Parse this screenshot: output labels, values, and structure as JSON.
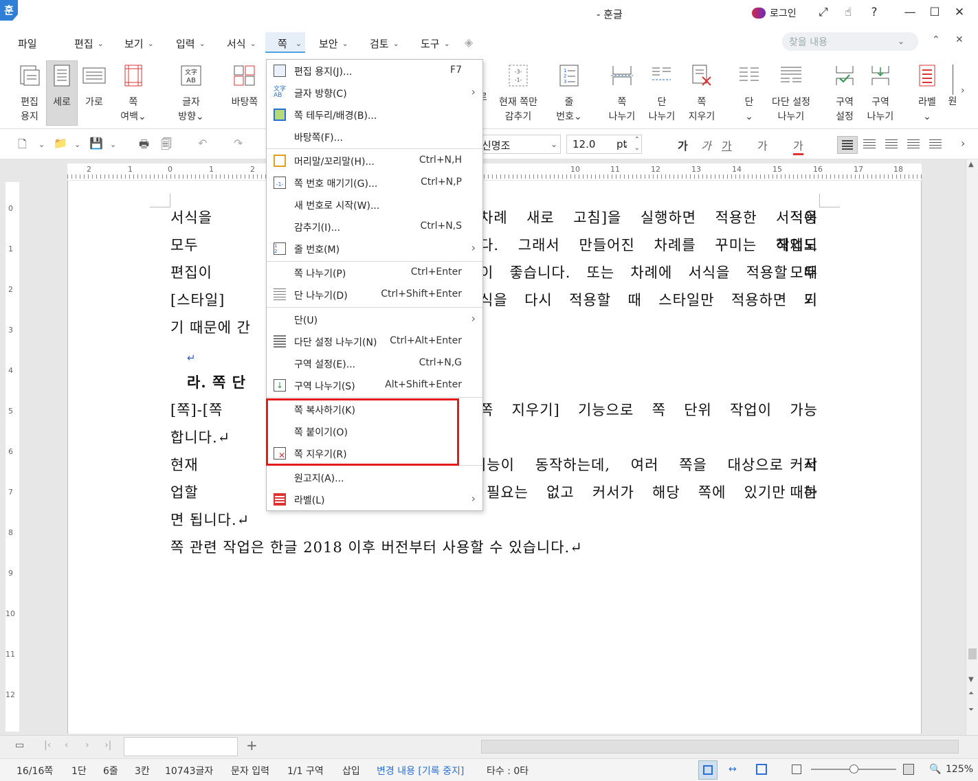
{
  "window": {
    "title": "- 훈글",
    "login": "로그인",
    "logo": "훈"
  },
  "menus": [
    "파일",
    "편집",
    "보기",
    "입력",
    "서식",
    "쪽",
    "보안",
    "검토",
    "도구"
  ],
  "search_placeholder": "찾을 내용",
  "ribbon": [
    {
      "label1": "편집",
      "label2": "용지"
    },
    {
      "label1": "세로",
      "label2": ""
    },
    {
      "label1": "가로",
      "label2": ""
    },
    {
      "label1": "쪽",
      "label2": "여백⌄"
    },
    {
      "label1": "글자",
      "label2": "방향⌄"
    },
    {
      "label1": "바탕쪽",
      "label2": ""
    },
    {
      "label1": "현재 쪽만",
      "label2": "감추기"
    },
    {
      "label1": "줄",
      "label2": "번호⌄"
    },
    {
      "label1": "쪽",
      "label2": "나누기"
    },
    {
      "label1": "단",
      "label2": "나누기"
    },
    {
      "label1": "쪽",
      "label2": "지우기"
    },
    {
      "label1": "단",
      "label2": "⌄"
    },
    {
      "label1": "다단 설정",
      "label2": "나누기"
    },
    {
      "label1": "구역",
      "label2": "설정"
    },
    {
      "label1": "구역",
      "label2": "나누기"
    },
    {
      "label1": "라벨",
      "label2": "⌄"
    },
    {
      "label1": "원",
      "label2": ""
    }
  ],
  "ribbon_partial": "로",
  "font": {
    "name": "신명조",
    "size": "12.0",
    "unit": "pt"
  },
  "format_glyphs": [
    "가",
    "가",
    "가",
    "가",
    "가"
  ],
  "dropdown": [
    {
      "icon": "page-setup-icon",
      "label": "편집 용지(J)...",
      "shortcut": "F7",
      "arrow": ""
    },
    {
      "icon": "text-direction-icon",
      "label": "글자 방향(C)",
      "shortcut": "",
      "arrow": "›"
    },
    {
      "icon": "page-border-icon",
      "label": "쪽 테두리/배경(B)...",
      "shortcut": "",
      "arrow": ""
    },
    {
      "icon": "",
      "label": "바탕쪽(F)...",
      "shortcut": "",
      "arrow": ""
    },
    {
      "icon": "header-footer-icon",
      "label": "머리말/꼬리말(H)...",
      "shortcut": "Ctrl+N,H",
      "arrow": ""
    },
    {
      "icon": "page-number-icon",
      "label": "쪽 번호 매기기(G)...",
      "shortcut": "Ctrl+N,P",
      "arrow": ""
    },
    {
      "icon": "",
      "label": "새 번호로 시작(W)...",
      "shortcut": "",
      "arrow": ""
    },
    {
      "icon": "",
      "label": "감추기(I)...",
      "shortcut": "Ctrl+N,S",
      "arrow": ""
    },
    {
      "icon": "line-number-icon",
      "label": "줄 번호(M)",
      "shortcut": "",
      "arrow": "›"
    },
    {
      "icon": "page-break-icon",
      "label": "쪽 나누기(P)",
      "shortcut": "Ctrl+Enter",
      "arrow": ""
    },
    {
      "icon": "column-break-icon",
      "label": "단 나누기(D)",
      "shortcut": "Ctrl+Shift+Enter",
      "arrow": ""
    },
    {
      "icon": "",
      "label": "단(U)",
      "shortcut": "",
      "arrow": "›"
    },
    {
      "icon": "multi-column-icon",
      "label": "다단 설정 나누기(N)",
      "shortcut": "Ctrl+Alt+Enter",
      "arrow": ""
    },
    {
      "icon": "",
      "label": "구역 설정(E)...",
      "shortcut": "Ctrl+N,G",
      "arrow": ""
    },
    {
      "icon": "section-break-icon",
      "label": "구역 나누기(S)",
      "shortcut": "Alt+Shift+Enter",
      "arrow": ""
    },
    {
      "icon": "",
      "label": "쪽 복사하기(K)",
      "shortcut": "",
      "arrow": ""
    },
    {
      "icon": "",
      "label": "쪽 붙이기(O)",
      "shortcut": "",
      "arrow": ""
    },
    {
      "icon": "delete-page-icon",
      "label": "쪽 지우기(R)",
      "shortcut": "",
      "arrow": ""
    },
    {
      "icon": "",
      "label": "원고지(A)...",
      "shortcut": "",
      "arrow": ""
    },
    {
      "icon": "label-icon",
      "label": "라벨(L)",
      "shortcut": "",
      "arrow": "›"
    }
  ],
  "doc_lines": [
    {
      "left": "서식을 적용",
      "right": "차례 새로 고침]을 실행하면 적용한 서식이"
    },
    {
      "left": "모두 해제되",
      "right": "다. 그래서 만들어진 차례를 꾸미는 작업도"
    },
    {
      "left": "편집이 모두",
      "right": "이 좋습니다. 또는 차례에 서식을 적용할 때"
    },
    {
      "left": "[스타일] 기",
      "right": "식을 다시 적용할 때 스타일만 적용하면 되"
    },
    {
      "left": "기 때문에 간",
      "right": ""
    },
    {
      "left": "",
      "right": ""
    },
    {
      "left": "라. 쪽 단",
      "right": ""
    },
    {
      "left": "  [쪽]-[쪽 ",
      "right": "쪽 지우기] 기능으로 쪽 단위 작업이 가능"
    },
    {
      "left": "합니다.↵",
      "right": ""
    },
    {
      "left": "  현재 커서",
      "right": "기능이 동작하는데, 여러 쪽을 대상으로 작"
    },
    {
      "left": "업할 때는 ",
      "right": "필요는 없고 커서가 해당 쪽에 있기만 하"
    },
    {
      "left": "면 됩니다.↵",
      "right": ""
    },
    {
      "left": "  쪽 관련 작업은 한글 2018 이후 버전부터 사용할 수 있습니다.↵",
      "right": ""
    }
  ],
  "hruler": [
    "2",
    "1",
    "0",
    "1",
    "2",
    "10",
    "11",
    "12",
    "13",
    "14",
    "15",
    "16",
    "17",
    "18"
  ],
  "vruler": [
    "0",
    "1",
    "2",
    "3",
    "4",
    "5",
    "6",
    "7",
    "8",
    "9",
    "10",
    "11",
    "12"
  ],
  "status": [
    "16/16쪽",
    "1단",
    "6줄",
    "3칸",
    "10743글자",
    "문자 입력",
    "1/1 구역",
    "삽입",
    "변경 내용 [기록 중지]",
    "타수 : 0타"
  ],
  "zoom": "125%"
}
